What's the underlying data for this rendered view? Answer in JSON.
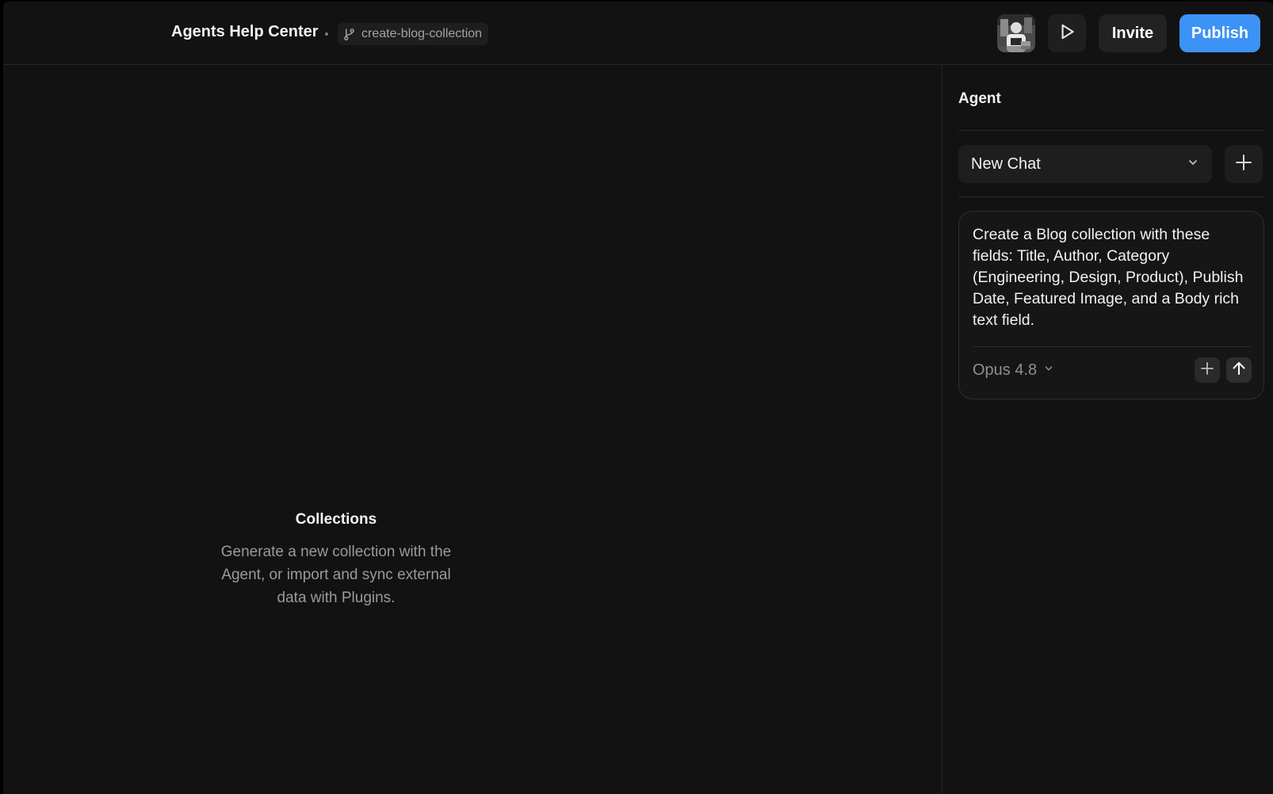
{
  "header": {
    "project_title": "Agents Help Center",
    "branch_name": "create-blog-collection",
    "branch_icon": "git-branch-icon",
    "invite_label": "Invite",
    "publish_label": "Publish",
    "publish_color": "#3c93f5"
  },
  "canvas": {
    "empty_title": "Collections",
    "empty_description": "Generate a new collection with the Agent, or import and sync external data with Plugins."
  },
  "agent_panel": {
    "title": "Agent",
    "chat_select": {
      "value": "New Chat"
    },
    "composer": {
      "message": "Create a Blog collection with these fields: Title, Author, Category (Engineering, Design, Product), Publish Date, Featured Image, and a Body rich text field.",
      "model": "Opus 4.8"
    }
  }
}
